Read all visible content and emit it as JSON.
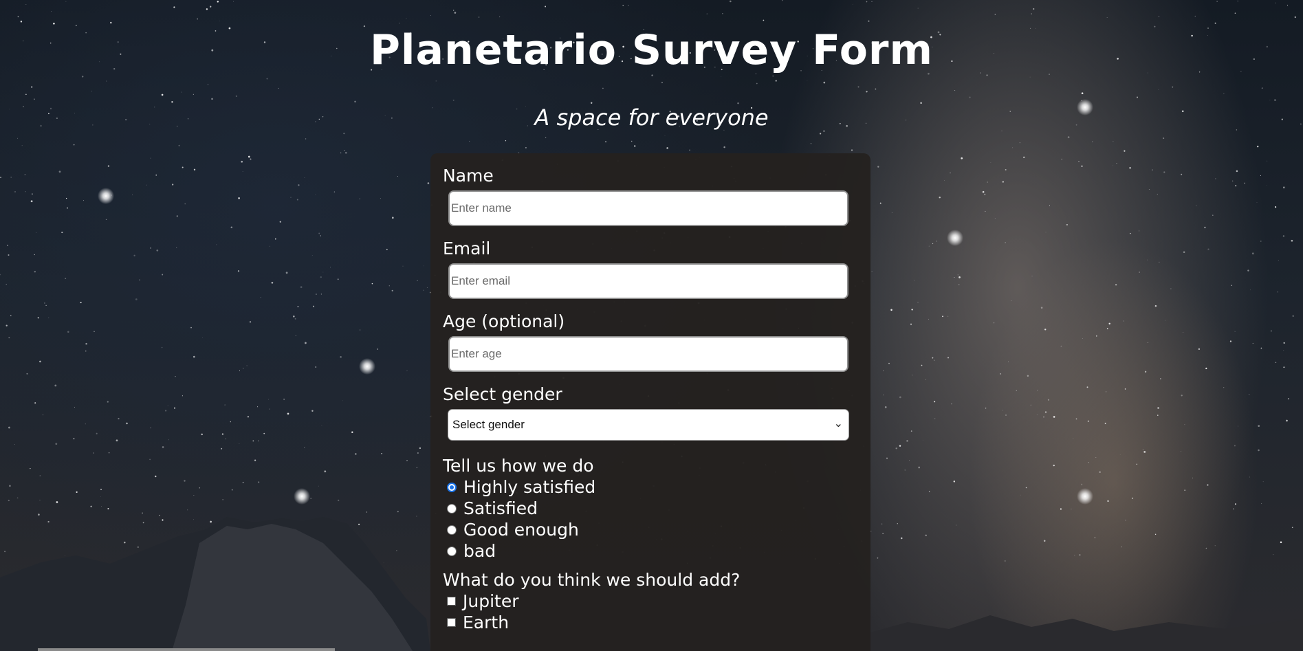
{
  "header": {
    "title": "Planetario Survey Form",
    "subtitle": "A space for everyone"
  },
  "form": {
    "name": {
      "label": "Name",
      "placeholder": "Enter name"
    },
    "email": {
      "label": "Email",
      "placeholder": "Enter email"
    },
    "age": {
      "label": "Age (optional)",
      "placeholder": "Enter age"
    },
    "gender": {
      "label": "Select gender",
      "selected": "Select gender",
      "chevron_icon": "chevron-down-icon"
    },
    "rating": {
      "title": "Tell us how we do",
      "options": [
        {
          "label": "Highly satisfied",
          "checked": true
        },
        {
          "label": "Satisfied",
          "checked": false
        },
        {
          "label": "Good enough",
          "checked": false
        },
        {
          "label": "bad",
          "checked": false
        }
      ]
    },
    "additions": {
      "title": "What do you think we should add?",
      "options": [
        {
          "label": "Jupiter",
          "checked": false
        },
        {
          "label": "Earth",
          "checked": false
        }
      ]
    }
  },
  "colors": {
    "radio_accent": "#1a73e8",
    "form_background": "#24211f"
  }
}
